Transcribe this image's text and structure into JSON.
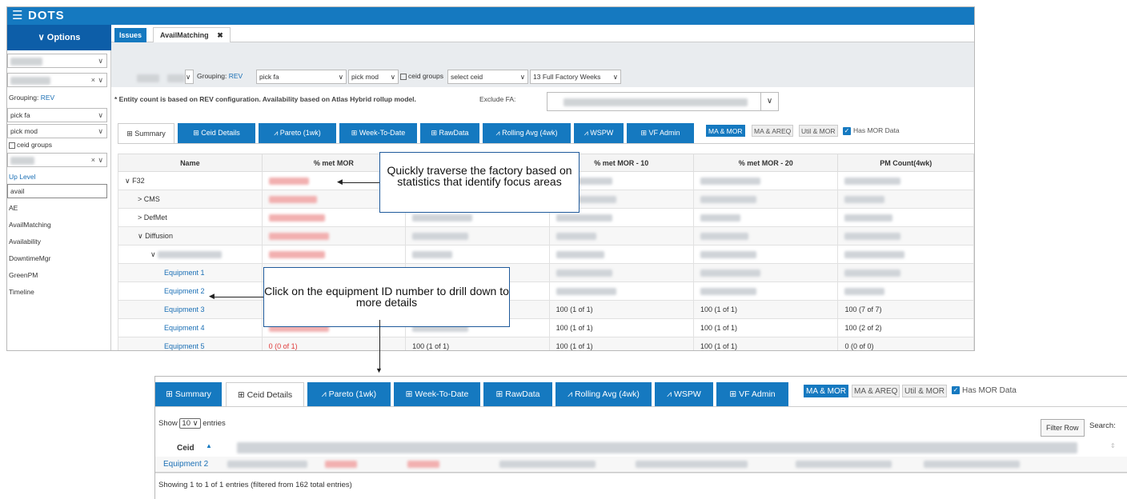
{
  "app": {
    "logo": "DOTS",
    "menu_icon": "hamburger-icon"
  },
  "options_label": "Options",
  "sidebar": {
    "grouping_prefix": "Grouping:",
    "grouping_value": "REV",
    "pick_fa": "pick fa",
    "pick_mod": "pick mod",
    "ceid_groups": "ceid groups",
    "up_level": "Up Level",
    "search_value": "avail",
    "items": [
      "AE",
      "AvailMatching",
      "Availability",
      "DowntimeMgr",
      "GreenPM",
      "Timeline"
    ]
  },
  "page_tabs": {
    "issues": "Issues",
    "avail": "AvailMatching",
    "close": "✖"
  },
  "filters": {
    "grouping_prefix": "Grouping:",
    "grouping_value": "REV",
    "pick_fa": "pick fa",
    "pick_mod": "pick mod",
    "ceid_groups": "ceid groups",
    "select_ceid": "select ceid",
    "weeks": "13 Full Factory Weeks"
  },
  "note": "* Entity count is based on REV configuration.   Availability based on Atlas Hybrid rollup model.",
  "exclude_fa": "Exclude FA:",
  "tabs": [
    "Summary",
    "Ceid Details",
    "Pareto (1wk)",
    "Week-To-Date",
    "RawData",
    "Rolling Avg (4wk)",
    "WSPW",
    "VF Admin"
  ],
  "toggles": [
    "MA & MOR",
    "MA & AREQ",
    "Util & MOR"
  ],
  "has_mor": "Has MOR Data",
  "table": {
    "columns": [
      "Name",
      "% met MOR",
      "",
      "% met MOR - 10",
      "% met MOR - 20",
      "PM Count(4wk)"
    ],
    "rows": [
      {
        "name": "F32",
        "indent": 0,
        "chev": "∨"
      },
      {
        "name": "CMS",
        "indent": 1,
        "chev": ">"
      },
      {
        "name": "DefMet",
        "indent": 1,
        "chev": ">"
      },
      {
        "name": "Diffusion",
        "indent": 1,
        "chev": "∨"
      },
      {
        "name": "",
        "indent": 2,
        "chev": "∨"
      },
      {
        "name": "Equipment 1",
        "indent": 3,
        "chev": ""
      },
      {
        "name": "Equipment 2",
        "indent": 3,
        "chev": ""
      },
      {
        "name": "Equipment 3",
        "indent": 3,
        "chev": "",
        "c3": "100 (1 of 1)",
        "c4": "100 (1 of 1)",
        "c5": "100 (7 of 7)"
      },
      {
        "name": "Equipment 4",
        "indent": 3,
        "chev": "",
        "c3": "100 (1 of 1)",
        "c4": "100 (1 of 1)",
        "c5": "100 (2 of 2)"
      },
      {
        "name": "Equipment 5",
        "indent": 3,
        "chev": "",
        "c1": "0 (0 of 1)",
        "c2": "100 (1 of 1)",
        "c3": "100 (1 of 1)",
        "c4": "100 (1 of 1)",
        "c5": "0 (0 of 0)"
      }
    ]
  },
  "callouts": {
    "top": "Quickly traverse the factory based on statistics that identify focus areas",
    "bottom": "Click on the equipment ID number to drill down to more details"
  },
  "bottom": {
    "show": "Show",
    "entries_count": "10",
    "entries": "entries",
    "filter_row": "Filter Row",
    "search": "Search:",
    "ceid_header": "Ceid",
    "row_value": "Equipment 2",
    "info": "Showing 1 to 1 of 1 entries (filtered from 162 total entries)"
  }
}
